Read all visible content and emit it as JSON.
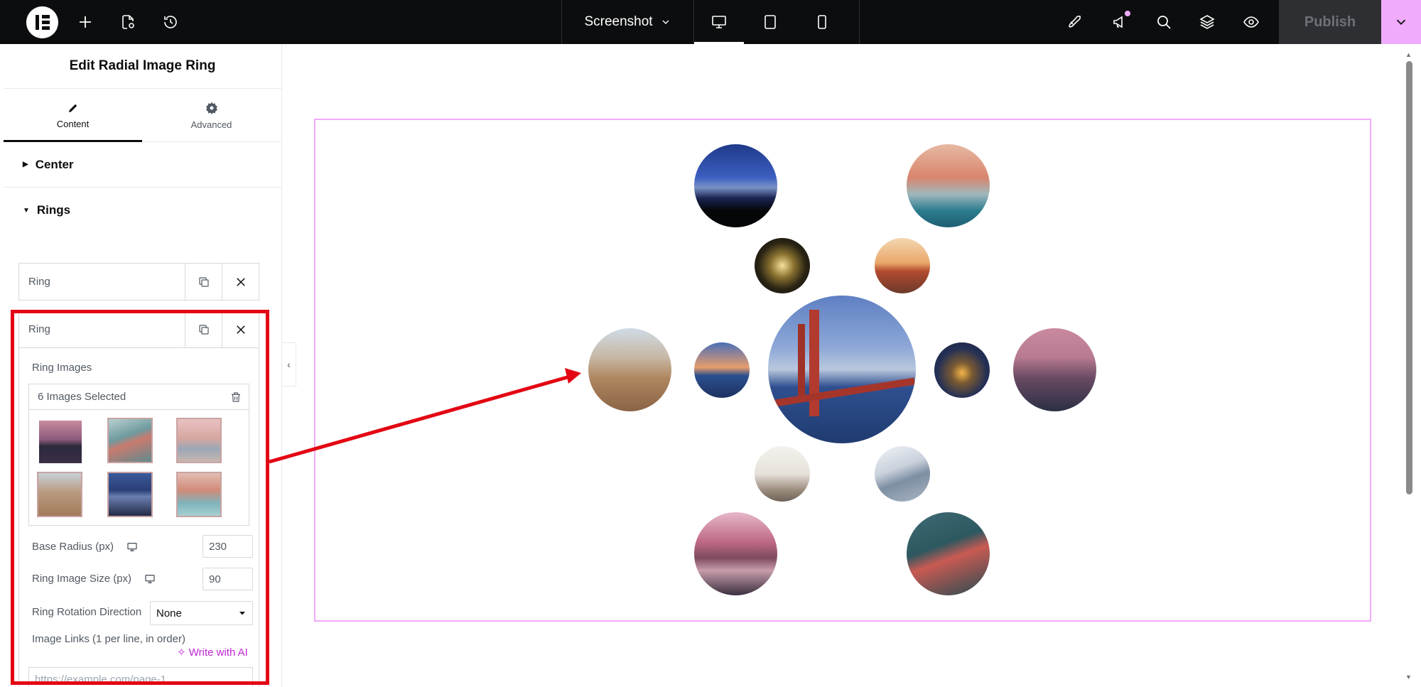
{
  "topbar": {
    "document_title": "Screenshot",
    "publish_label": "Publish",
    "icons": [
      "elementor-logo-icon",
      "add-icon",
      "page-settings-icon",
      "history-icon",
      "chevron-down-icon",
      "desktop-icon",
      "tablet-icon",
      "mobile-icon",
      "rocket-icon",
      "megaphone-icon",
      "search-icon",
      "layers-icon",
      "eye-icon",
      "chevron-down-icon"
    ],
    "accent": "#f0abfc"
  },
  "panel": {
    "title": "Edit Radial Image Ring",
    "tabs": [
      {
        "label": "Content",
        "icon": "pencil-icon"
      },
      {
        "label": "Advanced",
        "icon": "gear-icon"
      }
    ],
    "sections": {
      "center": "Center",
      "rings": "Rings"
    },
    "ring_items": [
      {
        "label": "Ring"
      },
      {
        "label": "Ring"
      }
    ],
    "ring_images_label": "Ring Images",
    "gallery_status": "6 Images Selected",
    "base_radius": {
      "label": "Base Radius (px)",
      "value": "230"
    },
    "ring_image_size": {
      "label": "Ring Image Size (px)",
      "value": "90"
    },
    "rotation": {
      "label": "Ring Rotation Direction",
      "value": "None"
    },
    "links": {
      "label": "Image Links (1 per line, in order)",
      "ai_label": "Write with AI",
      "placeholder": "https://example.com/page-1"
    }
  },
  "colors": {
    "highlight": "#e30613",
    "widget_border": "#f0abfc"
  }
}
